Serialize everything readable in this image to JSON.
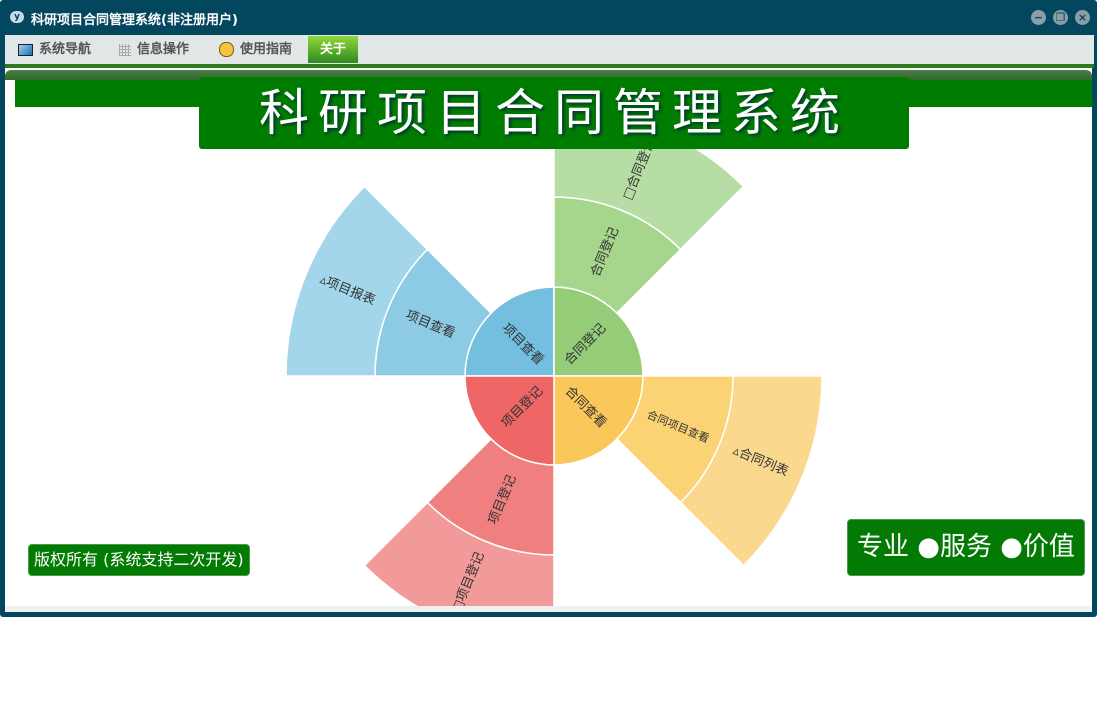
{
  "window": {
    "title": "科研项目合同管理系统(非注册用户)",
    "controls": [
      "minimize",
      "restore",
      "close"
    ]
  },
  "menu": {
    "items": [
      {
        "label": "系统导航",
        "icon": "monitor-icon"
      },
      {
        "label": "信息操作",
        "icon": "grid-icon"
      },
      {
        "label": "使用指南",
        "icon": "help-icon"
      },
      {
        "label": "关于",
        "active": true
      }
    ]
  },
  "header": {
    "title": "科研项目合同管理系统"
  },
  "footer": {
    "copyright": "版权所有 (系统支持二次开发)",
    "slogan": "专业 ●服务 ●价值"
  },
  "chart_data": {
    "type": "sunburst",
    "groups": [
      {
        "rings": [
          "项目查看",
          "项目查看",
          "▵项目报表"
        ],
        "colors": [
          "#74bfdf",
          "#8ccbe3",
          "#a3d6ea"
        ]
      },
      {
        "rings": [
          "合同登记",
          "合同登记",
          "□合同登记"
        ],
        "colors": [
          "#95cc78",
          "#a5d68b",
          "#b6dda3"
        ]
      },
      {
        "rings": [
          "合同查看",
          "合同项目查看",
          "▵合同列表"
        ],
        "colors": [
          "#fac75a",
          "#fbd374",
          "#fad98f"
        ]
      },
      {
        "rings": [
          "项目登记",
          "项目登记",
          "□项目登记"
        ],
        "colors": [
          "#ee6666",
          "#f08080",
          "#f29a9a"
        ]
      }
    ]
  }
}
